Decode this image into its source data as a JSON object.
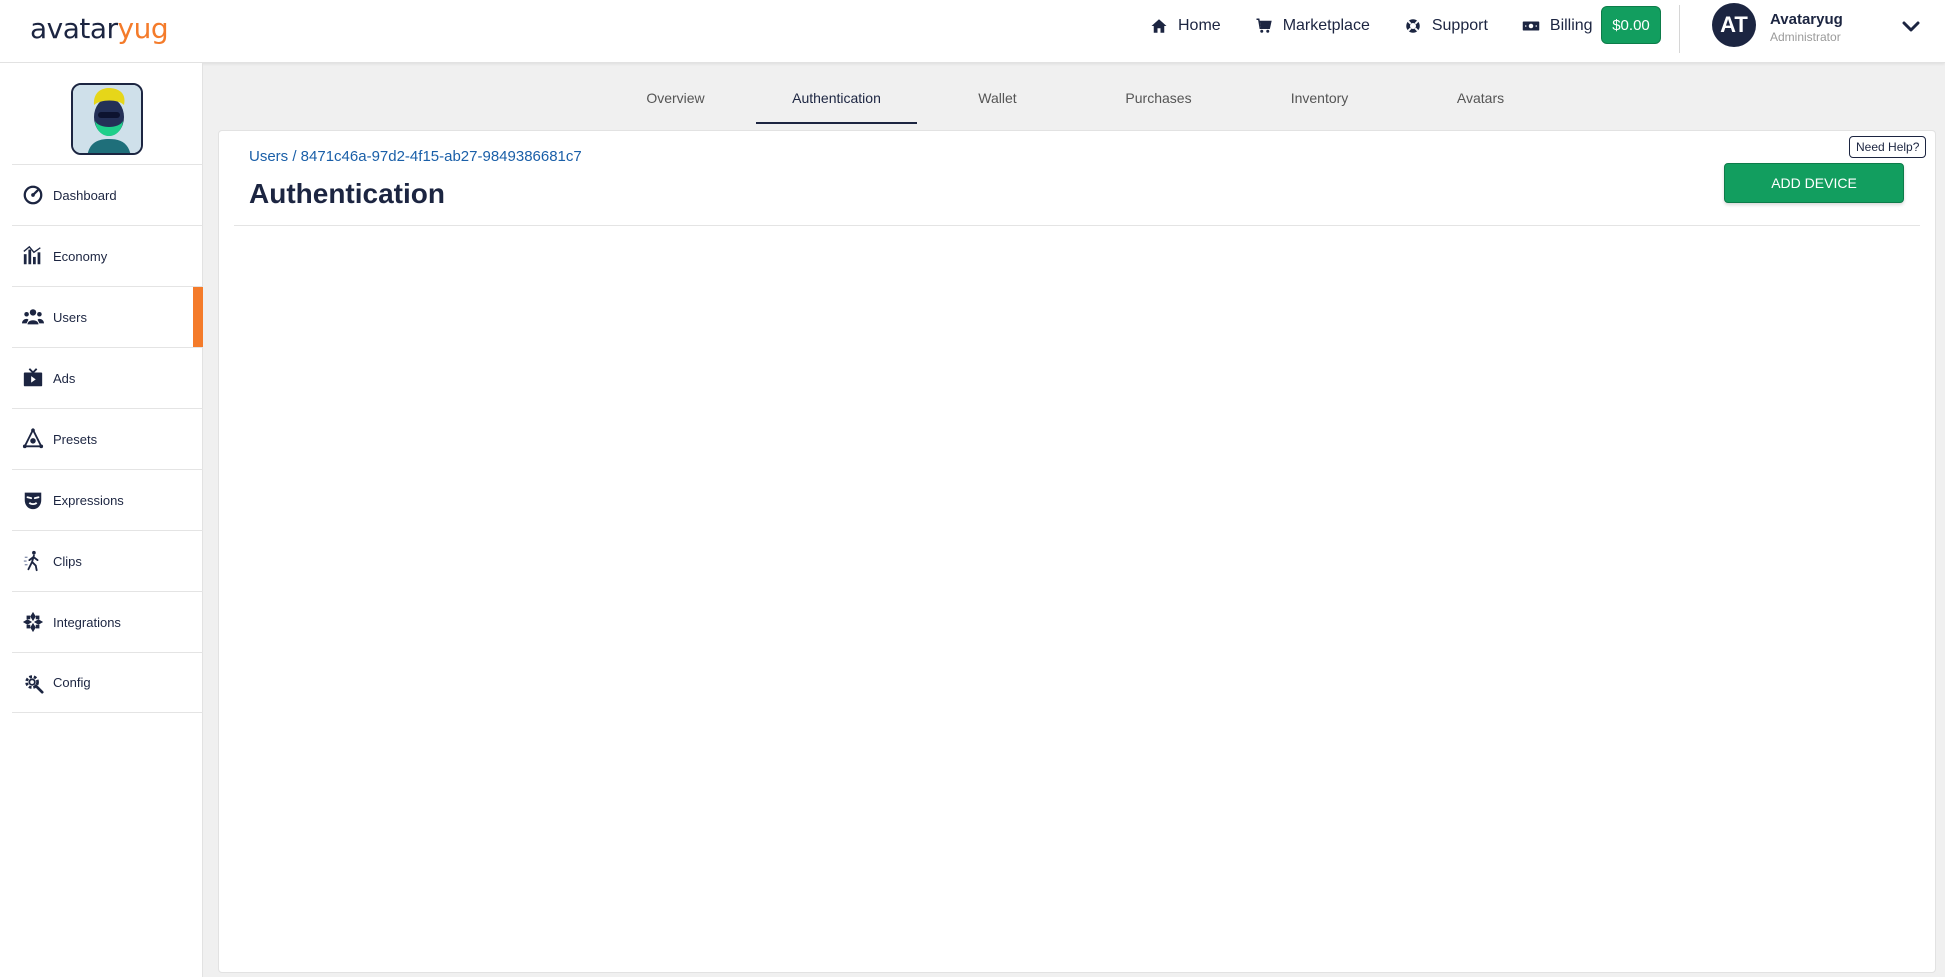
{
  "brand": {
    "logo_part1": "avatar",
    "logo_part2": "yug",
    "accent": "#f47b2a",
    "navy": "#1c2541",
    "green": "#129e5f"
  },
  "topnav": {
    "home": "Home",
    "marketplace": "Marketplace",
    "support": "Support",
    "billing": "Billing",
    "balance": "$0.00"
  },
  "user": {
    "initials": "AT",
    "name": "Avataryug",
    "role": "Administrator"
  },
  "sidebar": {
    "items": [
      {
        "label": "Dashboard",
        "icon": "gauge-icon"
      },
      {
        "label": "Economy",
        "icon": "bar-chart-icon"
      },
      {
        "label": "Users",
        "icon": "users-icon",
        "active": true
      },
      {
        "label": "Ads",
        "icon": "ads-icon"
      },
      {
        "label": "Presets",
        "icon": "presets-icon"
      },
      {
        "label": "Expressions",
        "icon": "mask-icon"
      },
      {
        "label": "Clips",
        "icon": "walking-figure-icon"
      },
      {
        "label": "Integrations",
        "icon": "integrations-icon"
      },
      {
        "label": "Config",
        "icon": "gear-icon"
      }
    ]
  },
  "tabs": [
    {
      "label": "Overview"
    },
    {
      "label": "Authentication",
      "active": true
    },
    {
      "label": "Wallet"
    },
    {
      "label": "Purchases"
    },
    {
      "label": "Inventory"
    },
    {
      "label": "Avatars"
    }
  ],
  "main": {
    "breadcrumb": "Users / 8471c46a-97d2-4f15-ab27-9849386681c7",
    "title": "Authentication",
    "help_label": "Need Help?",
    "add_button_label": "ADD DEVICE"
  }
}
